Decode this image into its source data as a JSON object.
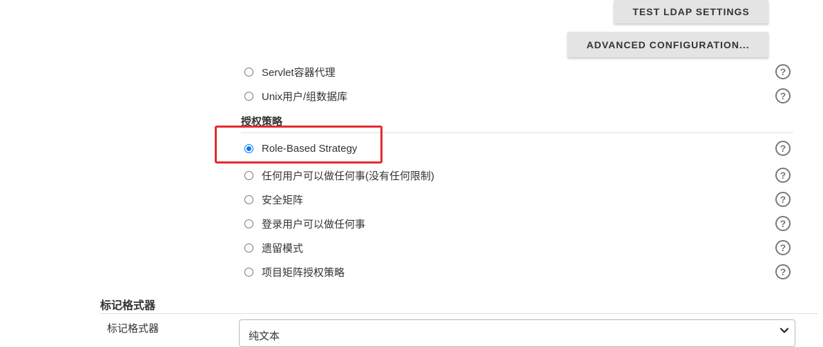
{
  "buttons": {
    "test_ldap": "TEST LDAP SETTINGS",
    "advanced": "ADVANCED CONFIGURATION..."
  },
  "security_realm": {
    "options": [
      {
        "label": "Servlet容器代理",
        "selected": false
      },
      {
        "label": "Unix用户/组数据库",
        "selected": false
      }
    ]
  },
  "authorization": {
    "title": "授权策略",
    "options": [
      {
        "label": "Role-Based Strategy",
        "selected": true
      },
      {
        "label": "任何用户可以做任何事(没有任何限制)",
        "selected": false
      },
      {
        "label": "安全矩阵",
        "selected": false
      },
      {
        "label": "登录用户可以做任何事",
        "selected": false
      },
      {
        "label": "遗留模式",
        "selected": false
      },
      {
        "label": "项目矩阵授权策略",
        "selected": false
      }
    ]
  },
  "markup_formatter": {
    "section_title": "标记格式器",
    "field_label": "标记格式器",
    "selected_value": "纯文本"
  },
  "help_icon_glyph": "?",
  "colors": {
    "accent": "#0075ff",
    "highlight": "#e5282e"
  }
}
